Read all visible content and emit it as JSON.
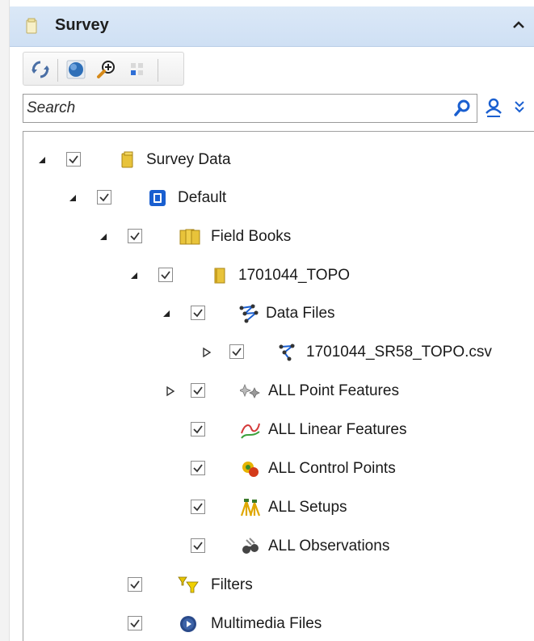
{
  "panel": {
    "title": "Survey",
    "folder_icon": "folder-icon",
    "collapse_icon": "chevron-up-icon"
  },
  "toolbar": {
    "buttons": [
      {
        "name": "refresh-icon"
      },
      {
        "name": "globe-icon"
      },
      {
        "name": "zoom-in-icon"
      },
      {
        "name": "grid-icon"
      }
    ]
  },
  "search": {
    "placeholder": "Search",
    "value": ""
  },
  "tree": {
    "survey_data": "Survey Data",
    "default": "Default",
    "field_books": "Field Books",
    "topo": "1701044_TOPO",
    "data_files": "Data Files",
    "csv_file": "1701044_SR58_TOPO.csv",
    "point_features": "ALL Point Features",
    "linear_features": "ALL Linear Features",
    "control_points": "ALL Control Points",
    "setups": "ALL Setups",
    "observations": "ALL Observations",
    "filters": "Filters",
    "multimedia": "Multimedia Files"
  },
  "colors": {
    "header_bg": "#cfe0f4",
    "accent_blue": "#1a5fd0",
    "folder_yellow": "#e8c33a"
  }
}
